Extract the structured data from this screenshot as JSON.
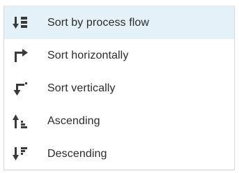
{
  "menu": {
    "items": [
      {
        "label": "Sort by process flow",
        "icon": "sort-process-flow-icon",
        "selected": true
      },
      {
        "label": "Sort horizontally",
        "icon": "sort-horizontal-icon",
        "selected": false
      },
      {
        "label": "Sort vertically",
        "icon": "sort-vertical-icon",
        "selected": false
      },
      {
        "label": "Ascending",
        "icon": "sort-ascending-icon",
        "selected": false
      },
      {
        "label": "Descending",
        "icon": "sort-descending-icon",
        "selected": false
      }
    ]
  },
  "colors": {
    "icon": "#3a3a3a",
    "text": "#2b2b2b",
    "selected_background": "#e5f1f8",
    "border": "#d9d9d9"
  }
}
